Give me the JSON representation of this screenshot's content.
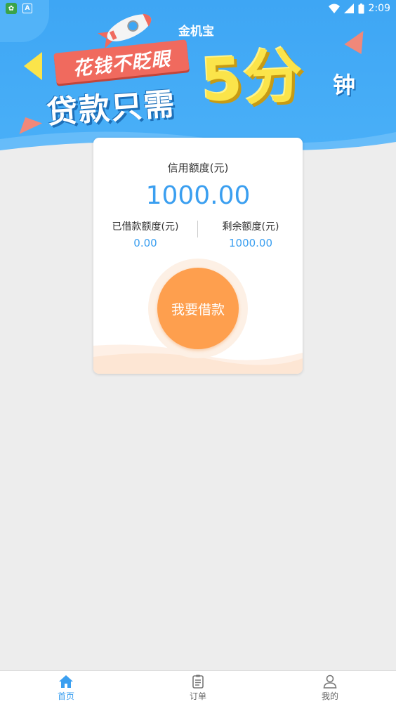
{
  "status_bar": {
    "time": "2:09"
  },
  "banner": {
    "app_name": "金机宝",
    "slogan_ribbon": "花钱不眨眼",
    "slogan_main": "贷款只需",
    "slogan_big": "5分",
    "slogan_small": "钟"
  },
  "card": {
    "credit_label": "信用额度(元)",
    "credit_amount": "1000.00",
    "borrowed_label": "已借款额度(元)",
    "borrowed_value": "0.00",
    "remaining_label": "剩余额度(元)",
    "remaining_value": "1000.00",
    "borrow_button": "我要借款"
  },
  "nav": {
    "items": [
      {
        "label": "首页",
        "icon": "home-icon",
        "active": true
      },
      {
        "label": "订单",
        "icon": "order-icon",
        "active": false
      },
      {
        "label": "我的",
        "icon": "user-icon",
        "active": false
      }
    ]
  },
  "colors": {
    "primary": "#3b9ff0",
    "banner": "#3ea6f4",
    "button": "#fe9f4e",
    "background": "#ededed"
  }
}
